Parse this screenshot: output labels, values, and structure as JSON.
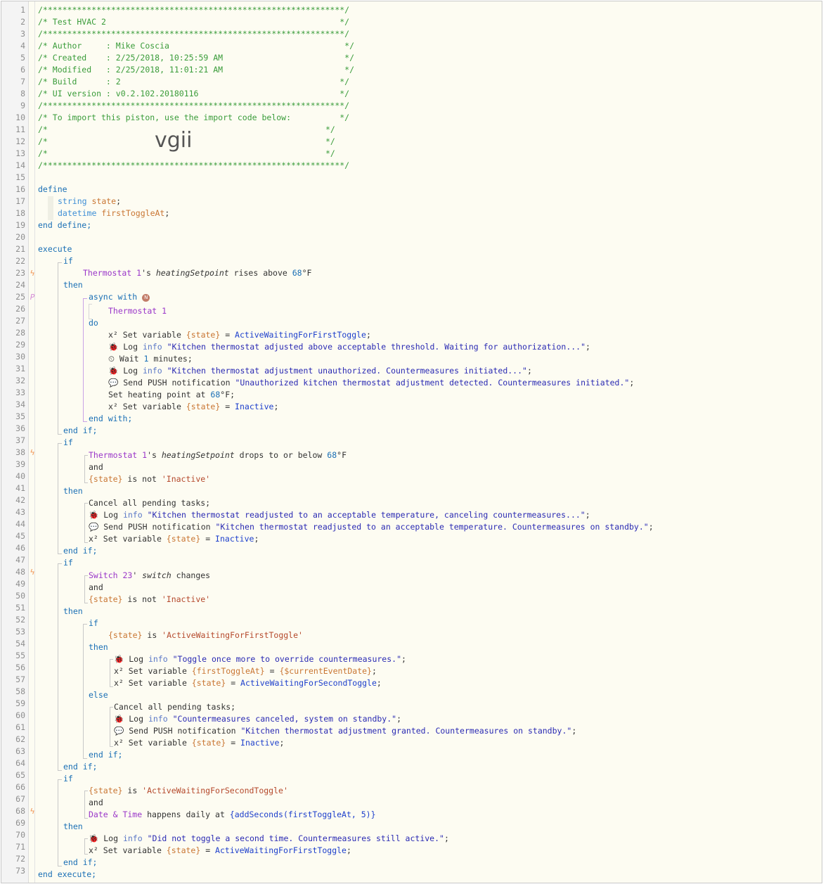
{
  "line_numbers": [
    "1",
    "2",
    "3",
    "4",
    "5",
    "6",
    "7",
    "8",
    "9",
    "10",
    "11",
    "12",
    "13",
    "14",
    "15",
    "16",
    "17",
    "18",
    "19",
    "20",
    "21",
    "22",
    "23",
    "24",
    "25",
    "26",
    "27",
    "28",
    "29",
    "30",
    "31",
    "32",
    "33",
    "34",
    "35",
    "36",
    "37",
    "38",
    "39",
    "40",
    "41",
    "42",
    "43",
    "44",
    "45",
    "46",
    "47",
    "48",
    "49",
    "50",
    "51",
    "52",
    "53",
    "54",
    "55",
    "56",
    "57",
    "58",
    "59",
    "60",
    "61",
    "62",
    "63",
    "64",
    "65",
    "66",
    "67",
    "68",
    "69",
    "70",
    "71",
    "72",
    "73"
  ],
  "gutter_markers": {
    "trigger": "ϟ",
    "parallel": "P",
    "trigger_lines": [
      23,
      38,
      48,
      68
    ],
    "parallel_lines": [
      25
    ]
  },
  "header": {
    "stars": "/**************************************************************/",
    "line2": "/* Test HVAC 2                                                */",
    "line4": "/* Author     : Mike Coscia                                    */",
    "line5": "/* Created    : 2/25/2018, 10:25:59 AM                         */",
    "line6": "/* Modified   : 2/25/2018, 11:01:21 AM                         */",
    "line7": "/* Build      : 2                                             */",
    "line8": "/* UI version : v0.2.102.20180116                             */",
    "line10": "/* To import this piston, use the import code below:          */",
    "blank_prefix": "/*",
    "blank_suffix": "*/",
    "import_code": "vgii"
  },
  "kw": {
    "define": "define",
    "end_define": "end define;",
    "execute": "execute",
    "end_execute": "end execute;",
    "if": "if",
    "then": "then",
    "else": "else",
    "do": "do",
    "and": "and",
    "end_if": "end if;",
    "async_with": "async with",
    "end_with": "end with;"
  },
  "decl": {
    "string_type": "string",
    "state_name": "state",
    "datetime_type": "datetime",
    "first_name": "firstToggleAt",
    "semi": ";"
  },
  "dev": {
    "thermostat_1": "Thermostat 1",
    "switch_23": "Switch 23",
    "date_time": "Date & Time"
  },
  "txt": {
    "poss_s": "'s ",
    "poss_apos": "' ",
    "heating_setpoint": "heatingSetpoint",
    "switch_attr": "switch",
    "rises_above": " rises above ",
    "drops_to_or_below": " drops to or below ",
    "changes": " changes",
    "deg_f": "°F",
    "num_68": "68",
    "num_1": "1",
    "state_var": "{state}",
    "first_var": "{firstToggleAt}",
    "current_event_date": "{$currentEventDate}",
    "is_not": " is not ",
    "is": " is ",
    "inactive_str": "'Inactive'",
    "awfft_str": "'ActiveWaitingForFirstToggle'",
    "awfst_str": "'ActiveWaitingForSecondToggle'",
    "happens_daily_at": " happens daily at ",
    "add_seconds": "{addSeconds(firstToggleAt, 5)}",
    "x2": "x²",
    "set_variable": " Set variable ",
    "eq": " = ",
    "semi": ";",
    "log": " Log ",
    "info": "info",
    "wait": " Wait ",
    "minutes": " minutes;",
    "send_push": " Send PUSH notification ",
    "set_heating_point": "Set heating point at ",
    "deg_f_semi": "°F;",
    "cancel_all": "Cancel all pending tasks;",
    "val_awfft": "ActiveWaitingForFirstToggle",
    "val_awfst": "ActiveWaitingForSecondToggle",
    "val_inactive": "Inactive",
    "n_badge": "N"
  },
  "icons": {
    "bug": "🐞",
    "clock": "⏲",
    "chat": "💬"
  },
  "strings": {
    "s1": "\"Kitchen thermostat adjusted above acceptable threshold. Waiting for authorization...\"",
    "s2": "\"Kitchen thermostat adjustment unauthorized. Countermeasures initiated...\"",
    "s3": "\"Unauthorized kitchen thermostat adjustment detected. Countermeasures initiated.\"",
    "s4": "\"Kitchen thermostat readjusted to an acceptable temperature, canceling countermeasures...\"",
    "s5": "\"Kitchen thermostat readjusted to an acceptable temperature. Countermeasures on standby.\"",
    "s6": "\"Toggle once more to override countermeasures.\"",
    "s7": "\"Countermeasures canceled, system on standby.\"",
    "s8": "\"Kitchen thermostat adjustment granted. Countermeasures on standby.\"",
    "s9": "\"Did not toggle a second time. Countermeasures still active.\""
  },
  "colors": {
    "comment": "#3a9c3a",
    "keyword": "#1a6fb5",
    "device": "#9a36c9",
    "variable": "#c97633",
    "string": "#b5492c",
    "log_string": "#2a2ab3",
    "value": "#1d3fcc",
    "trigger_marker": "#f0914f",
    "background": "#fdfcf2"
  }
}
